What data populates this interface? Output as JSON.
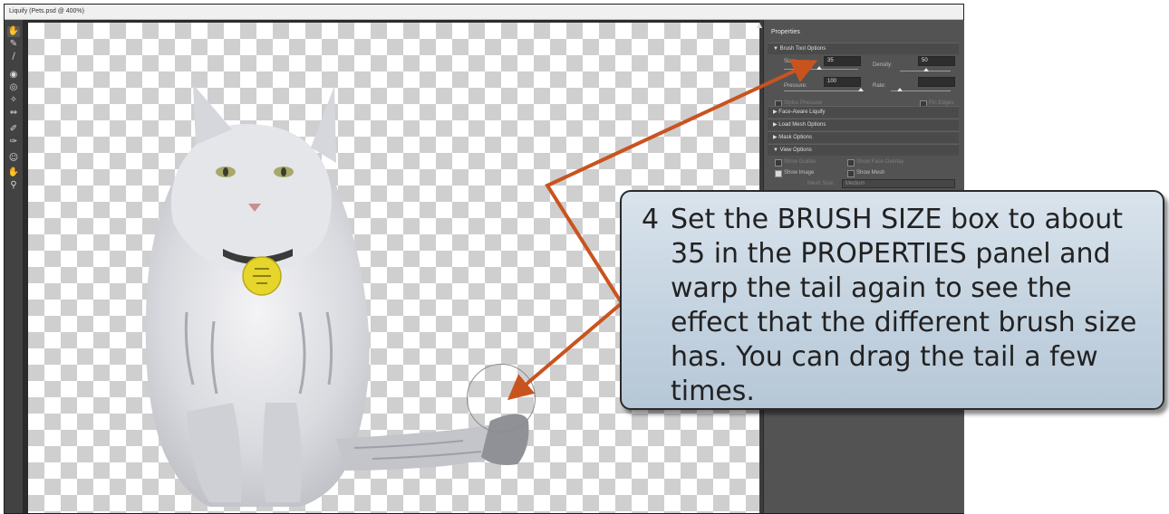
{
  "window": {
    "title": "Liquify (Pets.psd @ 400%)"
  },
  "toolbar": {
    "tools": [
      {
        "icon": "forward-warp-icon",
        "glyph": "✋"
      },
      {
        "icon": "reconstruct-icon",
        "glyph": "✎"
      },
      {
        "icon": "smooth-icon",
        "glyph": "∕"
      },
      {
        "icon": "twirl-icon",
        "glyph": "◉"
      },
      {
        "icon": "pucker-icon",
        "glyph": "◎"
      },
      {
        "icon": "bloat-icon",
        "glyph": "✧"
      },
      {
        "icon": "push-left-icon",
        "glyph": "⇔"
      },
      {
        "icon": "freeze-mask-icon",
        "glyph": "✐"
      },
      {
        "icon": "thaw-mask-icon",
        "glyph": "✑"
      },
      {
        "icon": "face-tool-icon",
        "glyph": "☺"
      },
      {
        "icon": "hand-icon",
        "glyph": "✋"
      },
      {
        "icon": "zoom-icon",
        "glyph": "⚲"
      }
    ]
  },
  "properties": {
    "title": "Properties",
    "brush_tool_options": {
      "header": "▼ Brush Tool Options",
      "size_label": "Size:",
      "size_value": "35",
      "density_label": "Density:",
      "density_value": "50",
      "pressure_label": "Pressure:",
      "pressure_value": "100",
      "rate_label": "Rate:",
      "rate_value": "",
      "stylus_pressure_label": "Stylus Pressure",
      "pin_edges_label": "Pin Edges"
    },
    "face_aware_header": "▶ Face-Aware Liquify",
    "load_mesh_header": "▶ Load Mesh Options",
    "mask_header": "▶ Mask Options",
    "view_options": {
      "header": "▼ View Options",
      "show_guides_label": "Show Guides",
      "show_face_overlay_label": "Show Face Overlay",
      "show_image_label": "Show Image",
      "show_mesh_label": "Show Mesh",
      "mesh_size_label": "Mesh Size:",
      "mesh_size_value": "Medium"
    }
  },
  "callout": {
    "step_number": "4",
    "text": "Set the BRUSH SIZE box to about 35 in the PROPERTIES panel and warp the tail again to see the effect that the different brush size has. You can drag the tail a few times."
  },
  "colors": {
    "arrow": "#c9531f",
    "panel": "#535353",
    "callout_fill": "#c7d5e2"
  }
}
